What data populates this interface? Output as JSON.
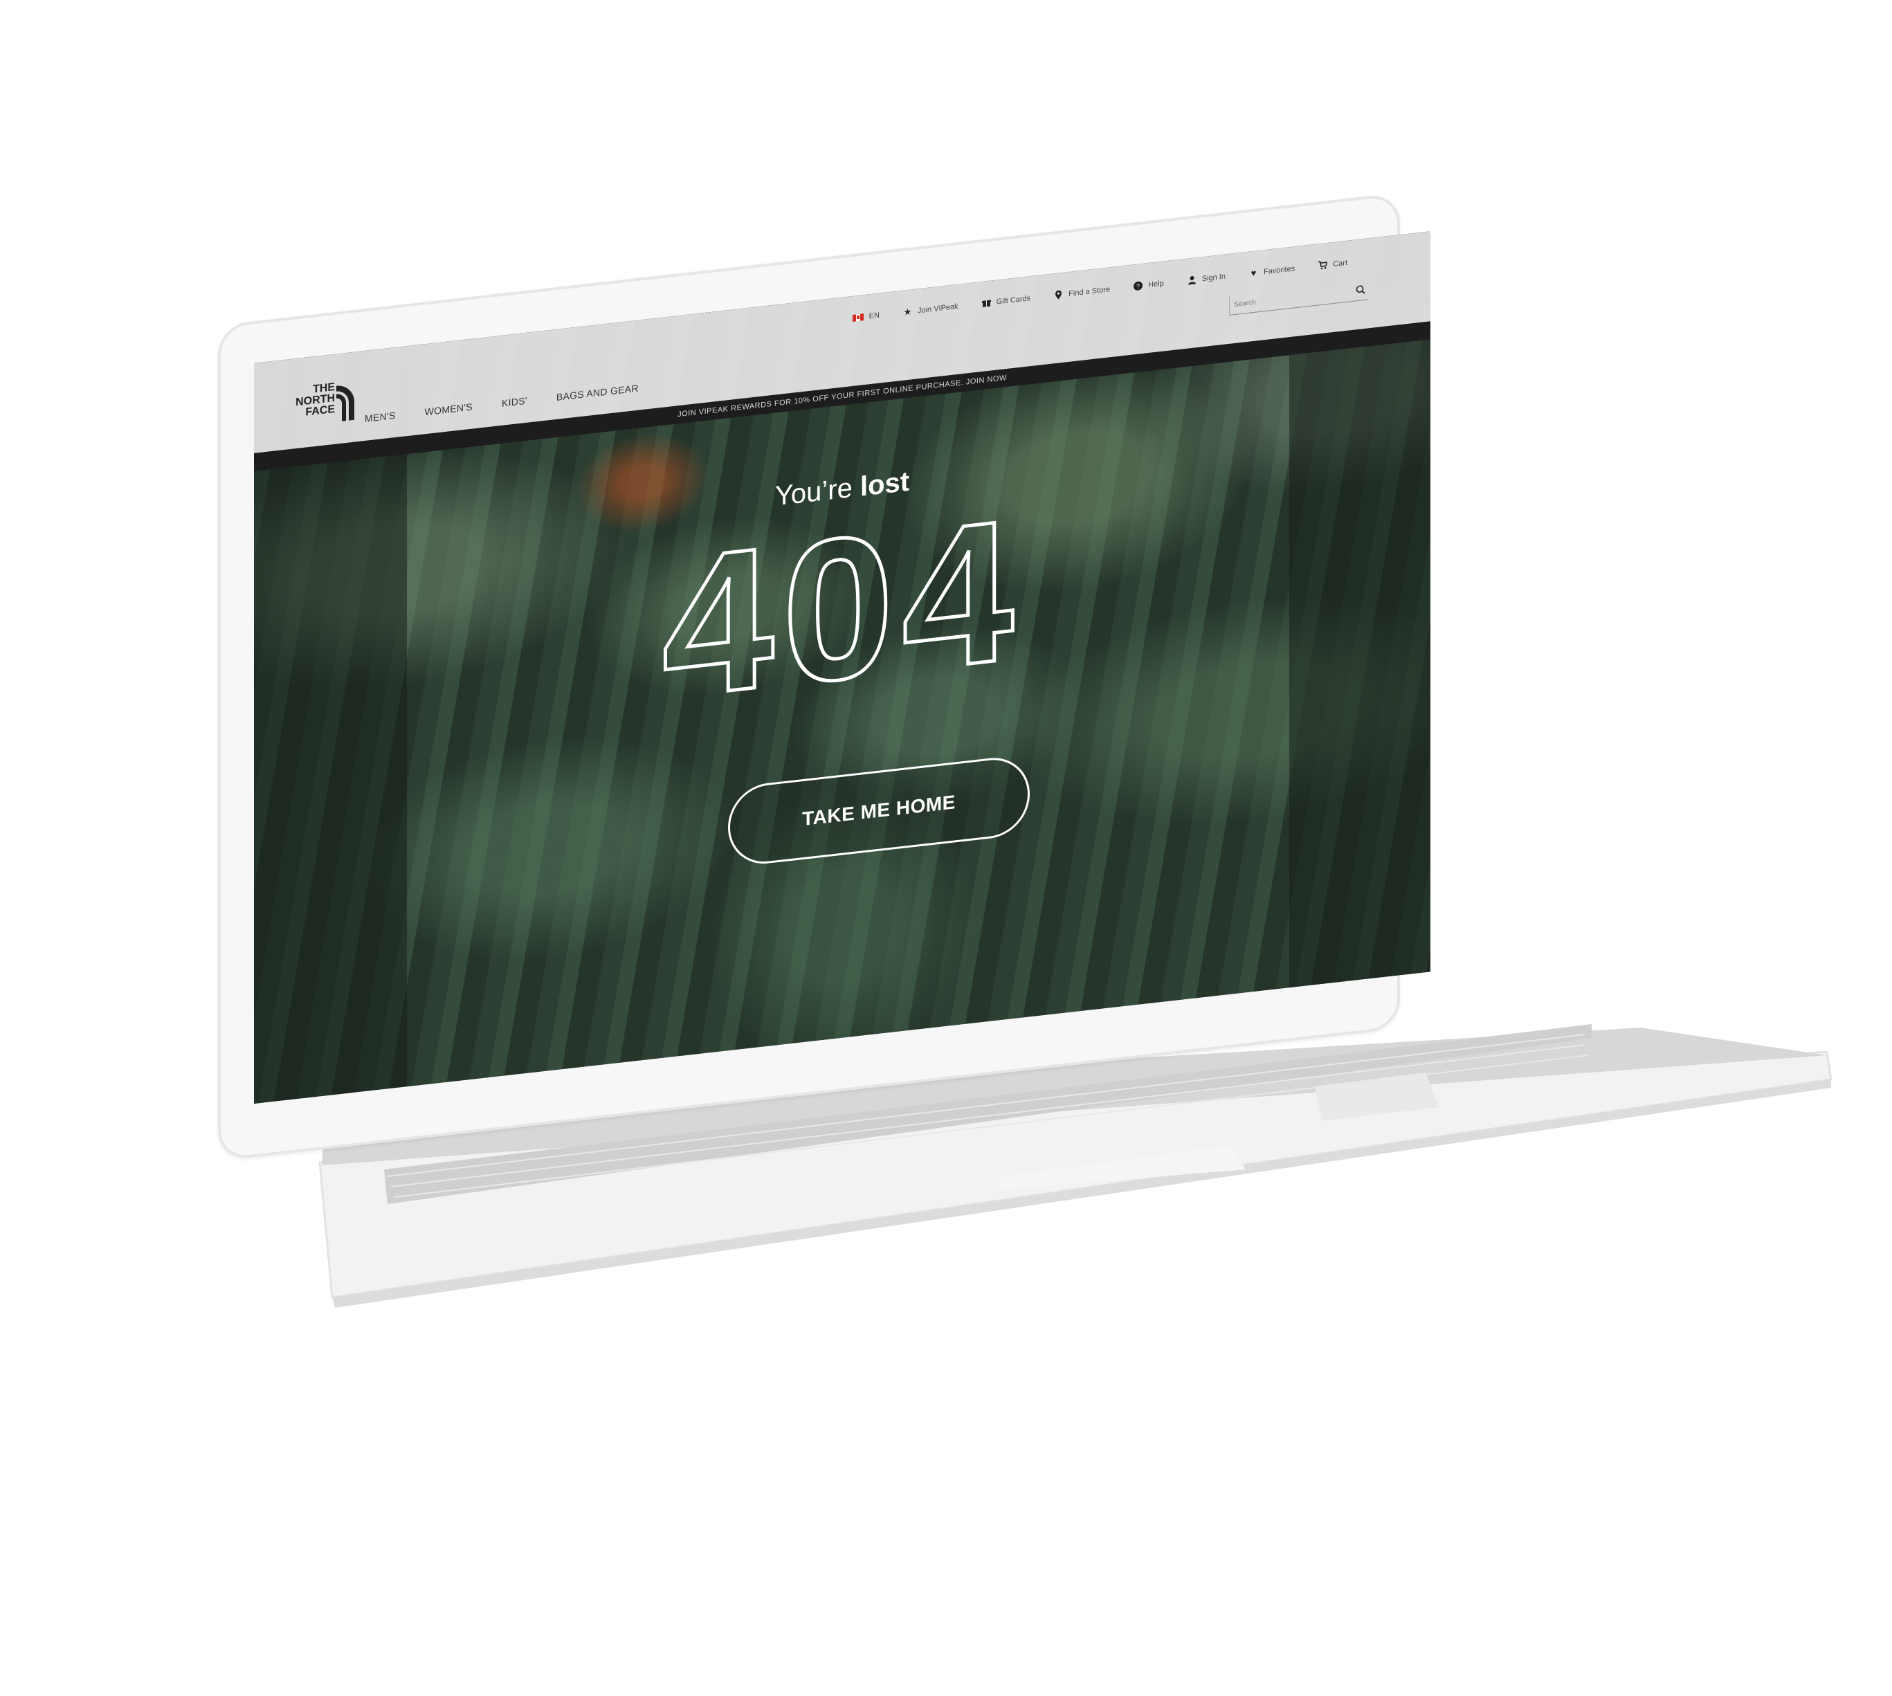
{
  "header": {
    "logo": [
      "THE",
      "NORTH",
      "FACE"
    ],
    "main_nav": [
      "MEN'S",
      "WOMEN'S",
      "KIDS'",
      "BAGS AND GEAR"
    ],
    "util_nav": [
      {
        "icon": "flag-canada-icon",
        "label": "EN"
      },
      {
        "icon": "star-icon",
        "label": "Join VIPeak"
      },
      {
        "icon": "gift-icon",
        "label": "Gift Cards"
      },
      {
        "icon": "location-pin-icon",
        "label": "Find a Store"
      },
      {
        "icon": "help-icon",
        "label": "Help"
      },
      {
        "icon": "user-icon",
        "label": "Sign In"
      },
      {
        "icon": "heart-icon",
        "label": "Favorites"
      },
      {
        "icon": "cart-icon",
        "label": "Cart"
      }
    ],
    "search": {
      "placeholder": "Search"
    }
  },
  "promo": {
    "text": "JOIN VIPEAK REWARDS FOR 10% OFF YOUR FIRST ONLINE PURCHASE. JOIN NOW"
  },
  "error_page": {
    "title_prefix": "You’re",
    "title_bold": "lost",
    "code": "404",
    "button_label": "TAKE ME HOME"
  },
  "colors": {
    "forest": "#2f4235",
    "header_bg": "#ececec",
    "promo_bg": "#1d1d1d",
    "text_light": "#ffffff"
  }
}
